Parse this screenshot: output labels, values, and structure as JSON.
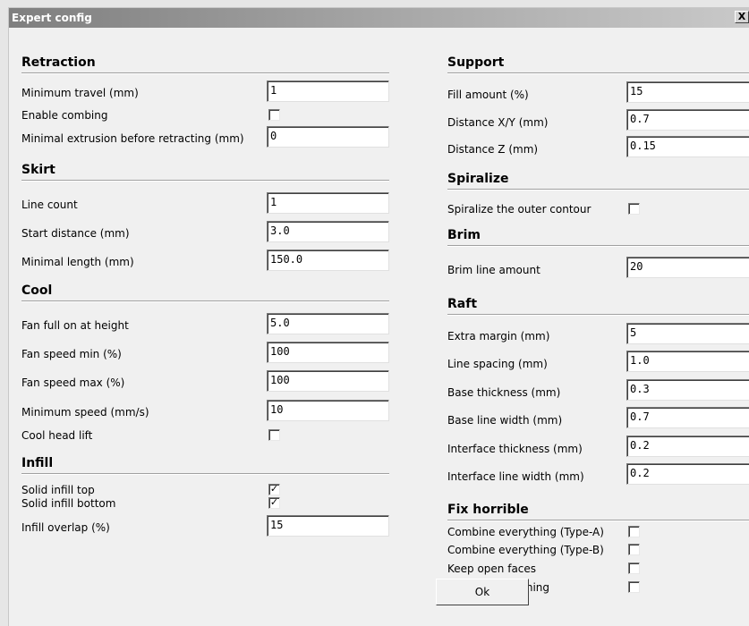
{
  "window": {
    "title": "Expert config",
    "close_glyph": "X"
  },
  "left": {
    "retraction": {
      "header": "Retraction",
      "min_travel": {
        "label": "Minimum travel (mm)",
        "value": "1"
      },
      "enable_combing": {
        "label": "Enable combing",
        "checked": false
      },
      "min_extrusion": {
        "label": "Minimal extrusion before retracting (mm)",
        "value": "0"
      }
    },
    "skirt": {
      "header": "Skirt",
      "line_count": {
        "label": "Line count",
        "value": "1"
      },
      "start_distance": {
        "label": "Start distance (mm)",
        "value": "3.0"
      },
      "minimal_length": {
        "label": "Minimal length (mm)",
        "value": "150.0"
      }
    },
    "cool": {
      "header": "Cool",
      "fan_full_on": {
        "label": "Fan full on at height",
        "value": "5.0"
      },
      "fan_speed_min": {
        "label": "Fan speed min (%)",
        "value": "100"
      },
      "fan_speed_max": {
        "label": "Fan speed max (%)",
        "value": "100"
      },
      "min_speed": {
        "label": "Minimum speed (mm/s)",
        "value": "10"
      },
      "head_lift": {
        "label": "Cool head lift",
        "checked": false
      }
    },
    "infill": {
      "header": "Infill",
      "solid_top": {
        "label": "Solid infill top",
        "checked": true,
        "mark": "✓"
      },
      "solid_bottom": {
        "label": "Solid infill bottom",
        "checked": true,
        "mark": "✓"
      },
      "overlap": {
        "label": "Infill overlap (%)",
        "value": "15"
      }
    }
  },
  "right": {
    "support": {
      "header": "Support",
      "fill_amount": {
        "label": "Fill amount (%)",
        "value": "15"
      },
      "distance_xy": {
        "label": "Distance X/Y (mm)",
        "value": "0.7"
      },
      "distance_z": {
        "label": "Distance Z (mm)",
        "value": "0.15"
      }
    },
    "spiralize": {
      "header": "Spiralize",
      "outer_contour": {
        "label": "Spiralize the outer contour",
        "checked": false
      }
    },
    "brim": {
      "header": "Brim",
      "line_amount": {
        "label": "Brim line amount",
        "value": "20"
      }
    },
    "raft": {
      "header": "Raft",
      "extra_margin": {
        "label": "Extra margin (mm)",
        "value": "5"
      },
      "line_spacing": {
        "label": "Line spacing (mm)",
        "value": "1.0"
      },
      "base_thickness": {
        "label": "Base thickness (mm)",
        "value": "0.3"
      },
      "base_line_width": {
        "label": "Base line width (mm)",
        "value": "0.7"
      },
      "interface_thickness": {
        "label": "Interface thickness (mm)",
        "value": "0.2"
      },
      "interface_line_width": {
        "label": "Interface line width (mm)",
        "value": "0.2"
      }
    },
    "fix_horrible": {
      "header": "Fix horrible",
      "combine_a": {
        "label": "Combine everything (Type-A)",
        "checked": false
      },
      "combine_b": {
        "label": "Combine everything (Type-B)",
        "checked": false
      },
      "keep_open": {
        "label": "Keep open faces",
        "checked": false
      },
      "extensive_stitching": {
        "label": "Extensive stitching",
        "checked": false
      }
    }
  },
  "ok_label": "Ok"
}
